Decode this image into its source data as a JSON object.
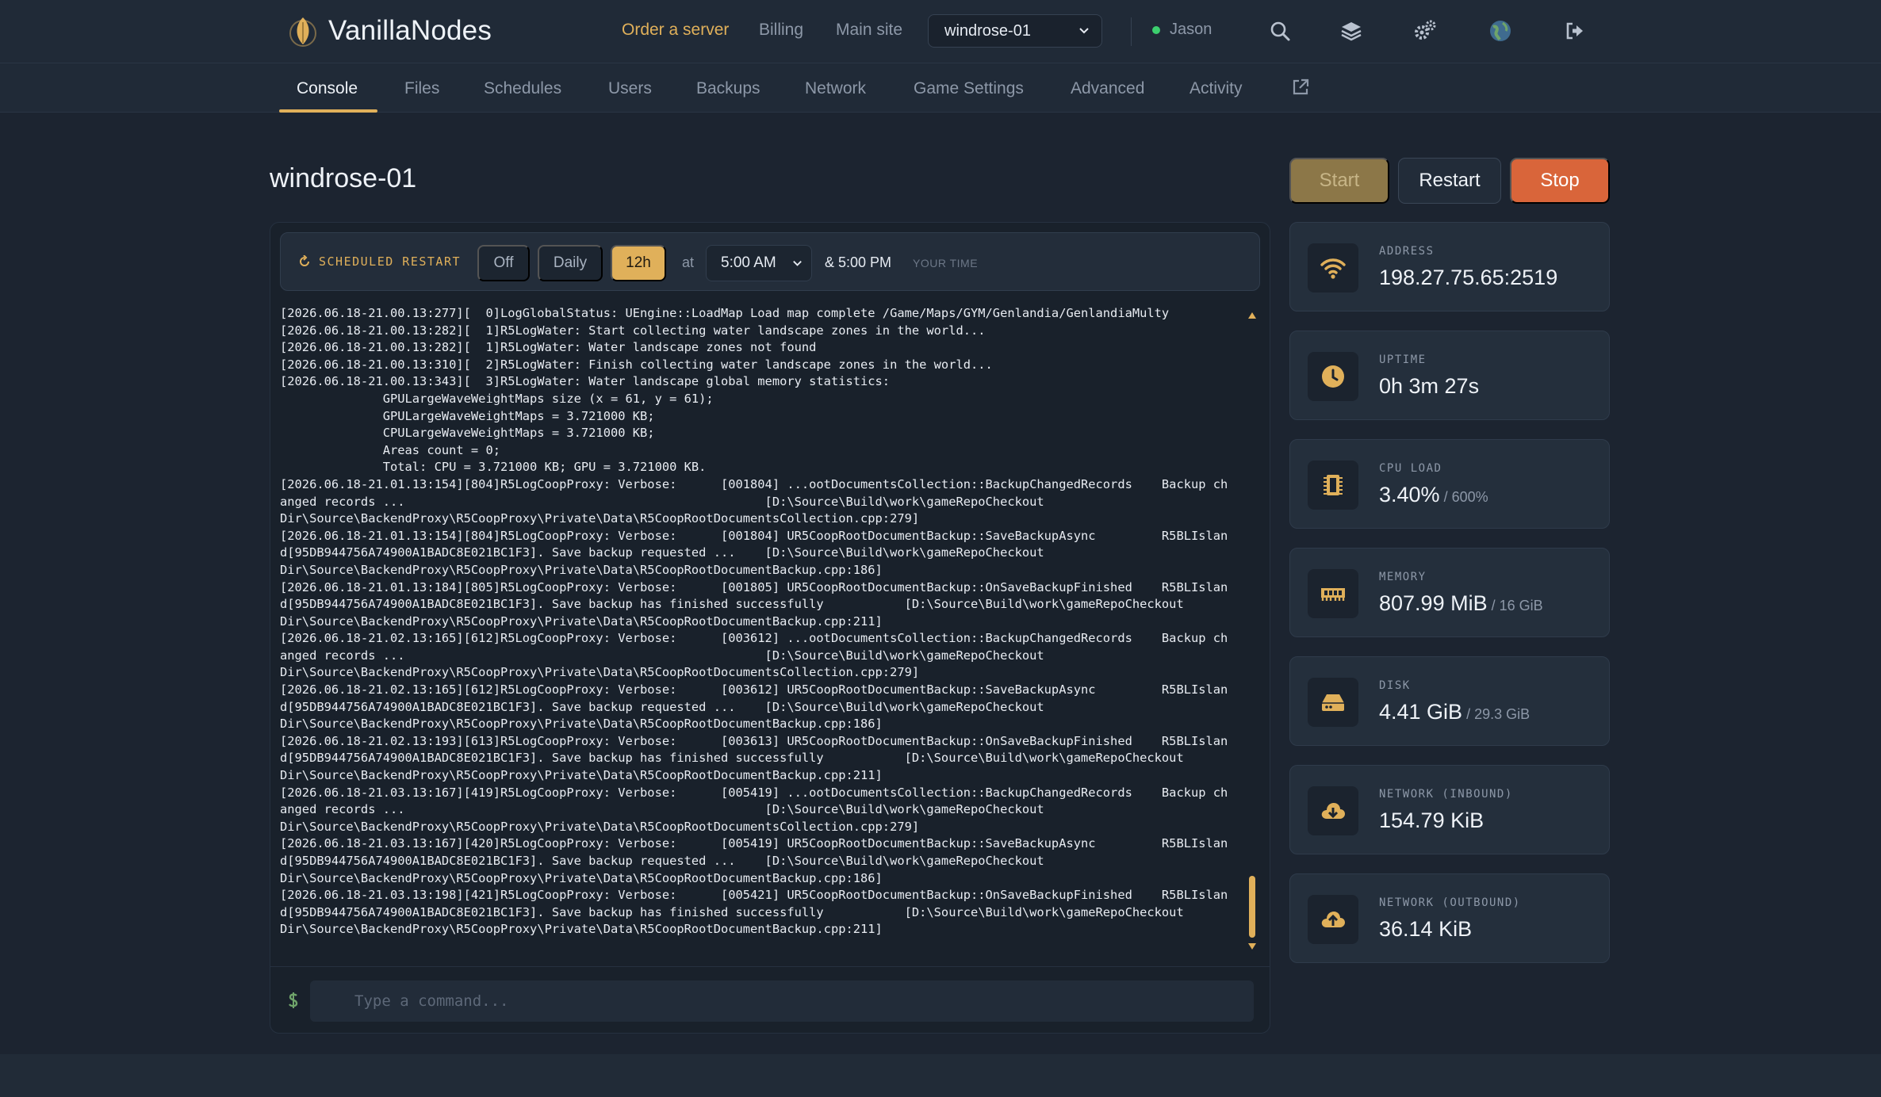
{
  "brand": {
    "name": "VanillaNodes"
  },
  "nav": {
    "order": "Order a server",
    "billing": "Billing",
    "main_site": "Main site",
    "server_select": "windrose-01",
    "user": "Jason"
  },
  "tabs": [
    "Console",
    "Files",
    "Schedules",
    "Users",
    "Backups",
    "Network",
    "Game Settings",
    "Advanced",
    "Activity"
  ],
  "page": {
    "title": "windrose-01"
  },
  "power": {
    "start": "Start",
    "restart": "Restart",
    "stop": "Stop"
  },
  "scheduled_restart": {
    "label": "SCHEDULED RESTART",
    "options": [
      "Off",
      "Daily",
      "12h"
    ],
    "selected": "12h",
    "at": "at",
    "time": "5:00 AM",
    "second_time": "& 5:00 PM",
    "your_time": "YOUR TIME"
  },
  "console": {
    "lines": [
      "[2026.06.18-21.00.13:277][  0]LogGlobalStatus: UEngine::LoadMap Load map complete /Game/Maps/GYM/Genlandia/GenlandiaMulty",
      "[2026.06.18-21.00.13:282][  1]R5LogWater: Start collecting water landscape zones in the world...",
      "[2026.06.18-21.00.13:282][  1]R5LogWater: Water landscape zones not found",
      "[2026.06.18-21.00.13:310][  2]R5LogWater: Finish collecting water landscape zones in the world...",
      "[2026.06.18-21.00.13:343][  3]R5LogWater: Water landscape global memory statistics:",
      "              GPULargeWaveWeightMaps size (x = 61, y = 61);",
      "              GPULargeWaveWeightMaps = 3.721000 KB;",
      "              CPULargeWaveWeightMaps = 3.721000 KB;",
      "              Areas count = 0;",
      "              Total: CPU = 3.721000 KB; GPU = 3.721000 KB.",
      "[2026.06.18-21.01.13:154][804]R5LogCoopProxy: Verbose:      [001804] ...ootDocumentsCollection::BackupChangedRecords    Backup ch",
      "anged records ...                                                 [D:\\Source\\Build\\work\\gameRepoCheckout",
      "Dir\\Source\\BackendProxy\\R5CoopProxy\\Private\\Data\\R5CoopRootDocumentsCollection.cpp:279]",
      "[2026.06.18-21.01.13:154][804]R5LogCoopProxy: Verbose:      [001804] UR5CoopRootDocumentBackup::SaveBackupAsync         R5BLIslan",
      "d[95DB944756A74900A1BADC8E021BC1F3]. Save backup requested ...    [D:\\Source\\Build\\work\\gameRepoCheckout",
      "Dir\\Source\\BackendProxy\\R5CoopProxy\\Private\\Data\\R5CoopRootDocumentBackup.cpp:186]",
      "[2026.06.18-21.01.13:184][805]R5LogCoopProxy: Verbose:      [001805] UR5CoopRootDocumentBackup::OnSaveBackupFinished    R5BLIslan",
      "d[95DB944756A74900A1BADC8E021BC1F3]. Save backup has finished successfully           [D:\\Source\\Build\\work\\gameRepoCheckout",
      "Dir\\Source\\BackendProxy\\R5CoopProxy\\Private\\Data\\R5CoopRootDocumentBackup.cpp:211]",
      "[2026.06.18-21.02.13:165][612]R5LogCoopProxy: Verbose:      [003612] ...ootDocumentsCollection::BackupChangedRecords    Backup ch",
      "anged records ...                                                 [D:\\Source\\Build\\work\\gameRepoCheckout",
      "Dir\\Source\\BackendProxy\\R5CoopProxy\\Private\\Data\\R5CoopRootDocumentsCollection.cpp:279]",
      "[2026.06.18-21.02.13:165][612]R5LogCoopProxy: Verbose:      [003612] UR5CoopRootDocumentBackup::SaveBackupAsync         R5BLIslan",
      "d[95DB944756A74900A1BADC8E021BC1F3]. Save backup requested ...    [D:\\Source\\Build\\work\\gameRepoCheckout",
      "Dir\\Source\\BackendProxy\\R5CoopProxy\\Private\\Data\\R5CoopRootDocumentBackup.cpp:186]",
      "[2026.06.18-21.02.13:193][613]R5LogCoopProxy: Verbose:      [003613] UR5CoopRootDocumentBackup::OnSaveBackupFinished    R5BLIslan",
      "d[95DB944756A74900A1BADC8E021BC1F3]. Save backup has finished successfully           [D:\\Source\\Build\\work\\gameRepoCheckout",
      "Dir\\Source\\BackendProxy\\R5CoopProxy\\Private\\Data\\R5CoopRootDocumentBackup.cpp:211]",
      "[2026.06.18-21.03.13:167][419]R5LogCoopProxy: Verbose:      [005419] ...ootDocumentsCollection::BackupChangedRecords    Backup ch",
      "anged records ...                                                 [D:\\Source\\Build\\work\\gameRepoCheckout",
      "Dir\\Source\\BackendProxy\\R5CoopProxy\\Private\\Data\\R5CoopRootDocumentsCollection.cpp:279]",
      "[2026.06.18-21.03.13:167][420]R5LogCoopProxy: Verbose:      [005419] UR5CoopRootDocumentBackup::SaveBackupAsync         R5BLIslan",
      "d[95DB944756A74900A1BADC8E021BC1F3]. Save backup requested ...    [D:\\Source\\Build\\work\\gameRepoCheckout",
      "Dir\\Source\\BackendProxy\\R5CoopProxy\\Private\\Data\\R5CoopRootDocumentBackup.cpp:186]",
      "[2026.06.18-21.03.13:198][421]R5LogCoopProxy: Verbose:      [005421] UR5CoopRootDocumentBackup::OnSaveBackupFinished    R5BLIslan",
      "d[95DB944756A74900A1BADC8E021BC1F3]. Save backup has finished successfully           [D:\\Source\\Build\\work\\gameRepoCheckout",
      "Dir\\Source\\BackendProxy\\R5CoopProxy\\Private\\Data\\R5CoopRootDocumentBackup.cpp:211]"
    ],
    "command_placeholder": "Type a command..."
  },
  "stats": {
    "address": {
      "label": "ADDRESS",
      "value": "198.27.75.65:2519",
      "icon": "wifi-icon"
    },
    "uptime": {
      "label": "UPTIME",
      "value": "0h 3m 27s",
      "icon": "clock-icon"
    },
    "cpu": {
      "label": "CPU LOAD",
      "value": "3.40%",
      "sub": " / 600%",
      "icon": "cpu-icon"
    },
    "memory": {
      "label": "MEMORY",
      "value": "807.99 MiB",
      "sub": " / 16 GiB",
      "icon": "memory-icon"
    },
    "disk": {
      "label": "DISK",
      "value": "4.41 GiB",
      "sub": " / 29.3 GiB",
      "icon": "disk-icon"
    },
    "net_in": {
      "label": "NETWORK (INBOUND)",
      "value": "154.79 KiB",
      "icon": "cloud-download-icon"
    },
    "net_out": {
      "label": "NETWORK (OUTBOUND)",
      "value": "36.14 KiB",
      "icon": "cloud-upload-icon"
    }
  },
  "colors": {
    "accent": "#e0b05a",
    "stop": "#d9653a",
    "online": "#3ccf6e",
    "background": "#1c2430"
  }
}
